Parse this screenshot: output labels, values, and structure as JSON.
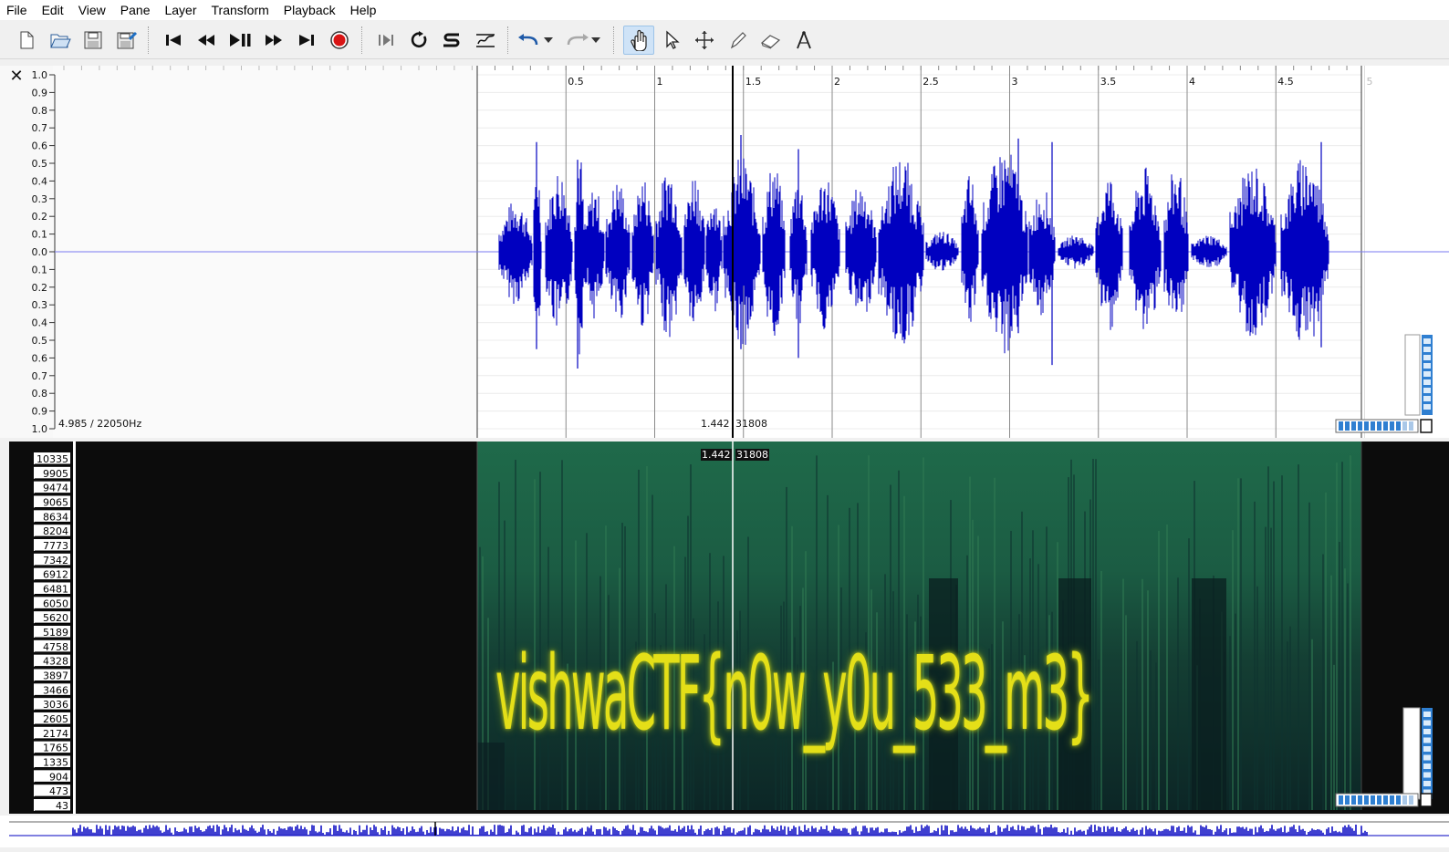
{
  "menu": [
    "File",
    "Edit",
    "View",
    "Pane",
    "Layer",
    "Transform",
    "Playback",
    "Help"
  ],
  "toolbar": {
    "file_tools": [
      "new-file-icon",
      "open-file-icon",
      "save-icon",
      "save-as-icon"
    ],
    "playback_tools": [
      "rewind-start-icon",
      "rewind-icon",
      "play-pause-icon",
      "fast-forward-icon",
      "ffwd-end-icon",
      "record-icon"
    ],
    "playmode_tools": [
      "play-selection-icon",
      "loop-icon",
      "solo-icon",
      "playback-speed-icon"
    ],
    "edit_tools": [
      "undo-icon",
      "redo-icon"
    ],
    "mode_tools": [
      "navigate-icon",
      "select-icon",
      "move-icon",
      "draw-icon",
      "erase-icon",
      "measure-icon"
    ]
  },
  "waveform": {
    "y_ticks_top": [
      "1.0",
      "0.9",
      "0.8",
      "0.7",
      "0.6",
      "0.5",
      "0.4",
      "0.3",
      "0.2",
      "0.1",
      "0.0"
    ],
    "y_ticks_bottom": [
      "0.1",
      "0.2",
      "0.3",
      "0.4",
      "0.5",
      "0.6",
      "0.7",
      "0.8",
      "0.9",
      "1.0"
    ],
    "time_ticks": [
      "0.5",
      "1",
      "1.5",
      "2",
      "2.5",
      "3",
      "3.5",
      "4",
      "4.5",
      "5"
    ],
    "info": "4.985 / 22050Hz",
    "playhead_time": "1.442",
    "playhead_frame": "31808",
    "wave_color": "#0000c0"
  },
  "spectrogram": {
    "freq_labels": [
      "10335",
      "9905",
      "9474",
      "9065",
      "8634",
      "8204",
      "7773",
      "7342",
      "6912",
      "6481",
      "6050",
      "5620",
      "5189",
      "4758",
      "4328",
      "3897",
      "3466",
      "3036",
      "2605",
      "2174",
      "1765",
      "1335",
      "904",
      "473",
      "43"
    ],
    "playhead_time": "1.442",
    "playhead_frame": "31808",
    "hidden_text": "vishwaCTF{n0w_y0u_533_m3}",
    "text_color": "#e6e01a",
    "background_color": "#1c5a42"
  }
}
